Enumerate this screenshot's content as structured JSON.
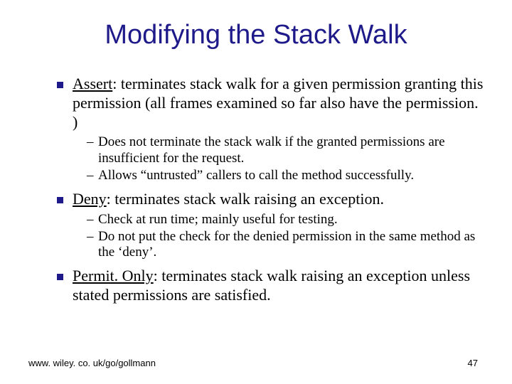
{
  "title": "Modifying the Stack Walk",
  "bullets": [
    {
      "term": "Assert",
      "rest": ": terminates stack walk for a given permission granting this permission (all frames examined so far also have the permission. )",
      "sub": [
        "Does not terminate the stack walk if the granted permissions are insufficient for the request.",
        "Allows “untrusted” callers to call the method successfully."
      ]
    },
    {
      "term": "Deny",
      "rest": ": terminates stack walk raising an exception.",
      "sub": [
        "Check at run time; mainly useful for testing.",
        "Do not put the check for the denied permission in the same method as the ‘deny’."
      ]
    },
    {
      "term": "Permit. Only",
      "rest": ": terminates stack walk raising an exception unless stated permissions are satisfied.",
      "sub": []
    }
  ],
  "footer": {
    "url": "www. wiley. co. uk/go/gollmann",
    "page": "47"
  }
}
